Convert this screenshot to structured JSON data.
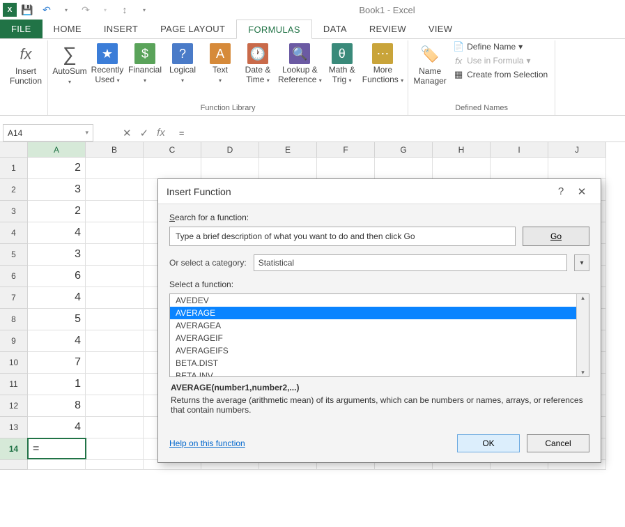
{
  "app": {
    "title": "Book1 - Excel"
  },
  "tabs": {
    "file": "FILE",
    "home": "HOME",
    "insert": "INSERT",
    "pageLayout": "PAGE LAYOUT",
    "formulas": "FORMULAS",
    "data": "DATA",
    "review": "REVIEW",
    "view": "VIEW"
  },
  "ribbon": {
    "insertFunction": "Insert\nFunction",
    "autoSum": "AutoSum",
    "recentlyUsed": "Recently\nUsed",
    "financial": "Financial",
    "logical": "Logical",
    "text": "Text",
    "dateTime": "Date &\nTime",
    "lookupRef": "Lookup &\nReference",
    "mathTrig": "Math &\nTrig",
    "moreFunctions": "More\nFunctions",
    "nameManager": "Name\nManager",
    "defineName": "Define Name",
    "useInFormula": "Use in Formula",
    "createFromSelection": "Create from Selection",
    "groupFunctionLibrary": "Function Library",
    "groupDefinedNames": "Defined Names"
  },
  "formulaBar": {
    "nameBox": "A14",
    "value": "="
  },
  "columns": [
    "A",
    "B",
    "C",
    "D",
    "E",
    "F",
    "G",
    "H",
    "I",
    "J"
  ],
  "rows": [
    {
      "n": "1",
      "v": "2"
    },
    {
      "n": "2",
      "v": "3"
    },
    {
      "n": "3",
      "v": "2"
    },
    {
      "n": "4",
      "v": "4"
    },
    {
      "n": "5",
      "v": "3"
    },
    {
      "n": "6",
      "v": "6"
    },
    {
      "n": "7",
      "v": "4"
    },
    {
      "n": "8",
      "v": "5"
    },
    {
      "n": "9",
      "v": "4"
    },
    {
      "n": "10",
      "v": "7"
    },
    {
      "n": "11",
      "v": "1"
    },
    {
      "n": "12",
      "v": "8"
    },
    {
      "n": "13",
      "v": "4"
    }
  ],
  "activeCell": {
    "row": "14",
    "value": "="
  },
  "dialog": {
    "title": "Insert Function",
    "searchLabel": "Search for a function:",
    "searchPlaceholder": "Type a brief description of what you want to do and then click Go",
    "go": "Go",
    "categoryLabel": "Or select a category:",
    "category": "Statistical",
    "selectLabel": "Select a function:",
    "functions": [
      "AVEDEV",
      "AVERAGE",
      "AVERAGEA",
      "AVERAGEIF",
      "AVERAGEIFS",
      "BETA.DIST",
      "BETA.INV"
    ],
    "selectedIndex": 1,
    "signature": "AVERAGE(number1,number2,...)",
    "description": "Returns the average (arithmetic mean) of its arguments, which can be numbers or names, arrays, or references that contain numbers.",
    "helpLink": "Help on this function",
    "ok": "OK",
    "cancel": "Cancel"
  }
}
